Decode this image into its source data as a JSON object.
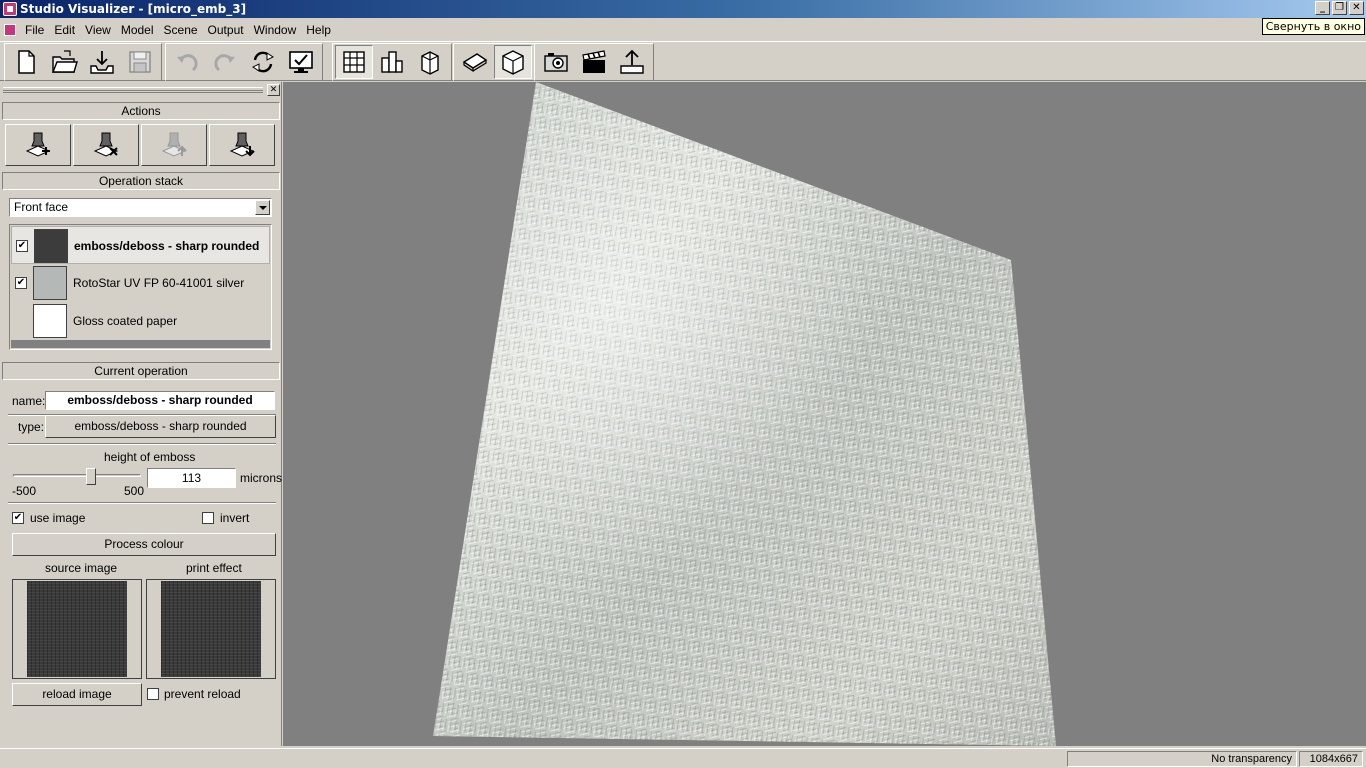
{
  "window": {
    "title": "Studio Visualizer - [micro_emb_3]",
    "minimize": "_",
    "restore": "❐",
    "close": "✕",
    "tooltip": "Свернуть в окно"
  },
  "menu": [
    "File",
    "Edit",
    "View",
    "Model",
    "Scene",
    "Output",
    "Window",
    "Help"
  ],
  "toolbar": {
    "groups": [
      [
        "new-file-icon",
        "open-folder-icon",
        "import-icon",
        "save-icon"
      ],
      [
        "undo-icon",
        "redo-icon",
        "refresh-icon",
        "display-icon"
      ],
      [
        "grid-view-icon",
        "bar-view-icon",
        "box-view-icon"
      ],
      [
        "flat-box-icon",
        "cube-icon"
      ],
      [
        "camera-icon",
        "clapper-icon",
        "export-icon"
      ]
    ]
  },
  "panel": {
    "close": "✕",
    "actions_header": "Actions",
    "action_buttons": [
      "add-operation-icon",
      "remove-operation-icon",
      "move-up-operation-icon",
      "move-down-operation-icon"
    ],
    "operation_stack_header": "Operation stack",
    "face_select": "Front face",
    "stack": [
      {
        "label": "emboss/deboss - sharp rounded",
        "checked": true,
        "selected": true,
        "thumb_color": "#3c3c3c"
      },
      {
        "label": "RotoStar UV FP 60-41001 silver",
        "checked": true,
        "selected": false,
        "thumb_color": "#b4b8b6"
      },
      {
        "label": "Gloss coated paper",
        "checked": false,
        "selected": false,
        "thumb_color": "#ffffff"
      }
    ],
    "current_operation_header": "Current operation",
    "name_label": "name:",
    "name_value": "emboss/deboss - sharp rounded",
    "type_label": "type:",
    "type_value": "emboss/deboss - sharp rounded",
    "height_label": "height of emboss",
    "slider_min": "-500",
    "slider_max": "500",
    "slider_level": 0.61,
    "height_value": "113",
    "height_unit": "microns",
    "use_image_label": "use image",
    "use_image_checked": true,
    "invert_label": "invert",
    "invert_checked": false,
    "process_button": "Process colour",
    "source_image_label": "source image",
    "print_effect_label": "print effect",
    "reload_button": "reload image",
    "prevent_reload_label": "prevent reload",
    "prevent_reload_checked": false
  },
  "status": {
    "transparency": "No transparency",
    "resolution": "1084x667"
  },
  "colors": {
    "viewport_bg": "#808080",
    "panel_bg": "#d4d0c8",
    "surface": "#c8ccc6"
  }
}
